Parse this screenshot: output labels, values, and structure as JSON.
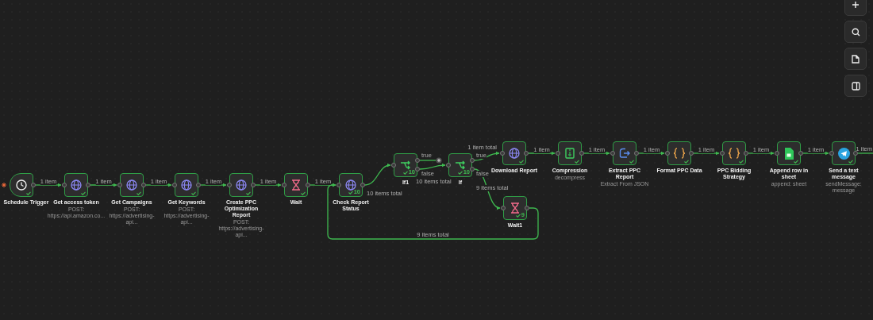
{
  "nodes": [
    {
      "name": "Schedule Trigger",
      "kind": "trigger",
      "succeeded": true
    },
    {
      "name": "Get access token",
      "subtitle": "POST: https://api.amazon.co...",
      "kind": "http",
      "succeeded": true
    },
    {
      "name": "Get Campaigns",
      "subtitle": "POST: https://advertising-api...",
      "kind": "http",
      "succeeded": true
    },
    {
      "name": "Get Keywords",
      "subtitle": "POST: https://advertising-api...",
      "kind": "http",
      "succeeded": true
    },
    {
      "name": "Create PPC Optimization Report",
      "subtitle": "POST: https://advertising-api...",
      "kind": "http",
      "succeeded": true
    },
    {
      "name": "Wait",
      "kind": "wait",
      "succeeded": true
    },
    {
      "name": "Check Report Status",
      "kind": "http",
      "succeeded": true,
      "count": "10"
    },
    {
      "name": "If1",
      "kind": "if",
      "succeeded": true,
      "count": "10",
      "outputs": [
        "true",
        "false"
      ]
    },
    {
      "name": "If",
      "kind": "if",
      "succeeded": true,
      "count": "10",
      "outputs": [
        "true",
        "false"
      ]
    },
    {
      "name": "Download Report",
      "kind": "http",
      "succeeded": true
    },
    {
      "name": "Compression",
      "subtitle": "decompress",
      "kind": "compression",
      "succeeded": true
    },
    {
      "name": "Extract PPC Report",
      "subtitle": "Extract From JSON",
      "kind": "extract",
      "succeeded": true
    },
    {
      "name": "Format PPC Data",
      "kind": "code",
      "succeeded": true
    },
    {
      "name": "PPC Bidding Strategy",
      "kind": "code",
      "succeeded": true
    },
    {
      "name": "Append row in sheet",
      "subtitle": "append: sheet",
      "kind": "sheets",
      "succeeded": true
    },
    {
      "name": "Send a text message",
      "subtitle": "sendMessage: message",
      "kind": "telegram",
      "succeeded": true
    },
    {
      "name": "Wait1",
      "kind": "wait",
      "succeeded": true,
      "count": "9"
    }
  ],
  "edges": [
    {
      "kind": "link",
      "label": "1 item"
    },
    {
      "kind": "link",
      "label": "1 item"
    },
    {
      "kind": "link",
      "label": "1 item"
    },
    {
      "kind": "link",
      "label": "1 item"
    },
    {
      "kind": "link",
      "label": "1 item"
    },
    {
      "kind": "link",
      "label": "1 item"
    },
    {
      "kind": "link",
      "label": "10 items total"
    },
    {
      "kind": "open"
    },
    {
      "kind": "link",
      "label": "10 items total"
    },
    {
      "kind": "link",
      "label": "1 item total"
    },
    {
      "kind": "link",
      "label": "9 items total"
    },
    {
      "kind": "link",
      "label": "1 item"
    },
    {
      "kind": "link",
      "label": "1 item"
    },
    {
      "kind": "link",
      "label": "1 item"
    },
    {
      "kind": "link",
      "label": "1 item"
    },
    {
      "kind": "link",
      "label": "1 item"
    },
    {
      "kind": "link",
      "label": "1 item"
    },
    {
      "kind": "offscreen",
      "label": "1 item"
    },
    {
      "kind": "loop",
      "label": "9 items total"
    }
  ]
}
